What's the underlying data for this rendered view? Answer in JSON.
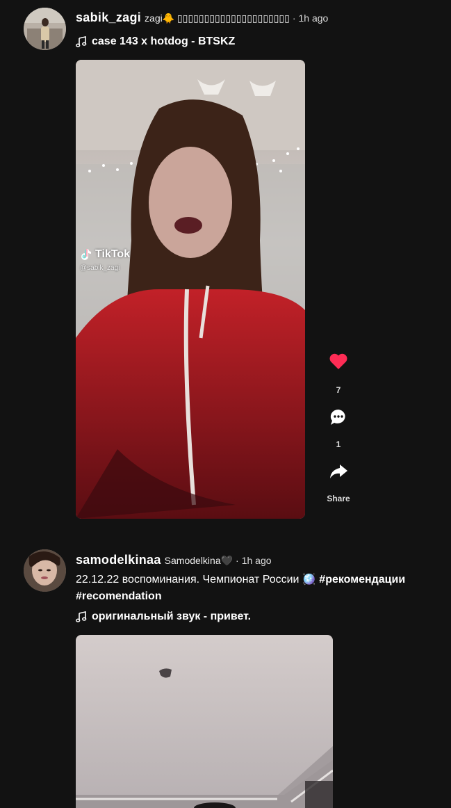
{
  "posts": [
    {
      "username": "sabik_zagi",
      "nickname": "zagi🐥 ▯▯▯▯▯▯▯▯▯▯▯▯▯▯▯▯▯▯▯▯▯",
      "separator": "·",
      "time": "1h ago",
      "music": "case 143 x hotdog - BTSKZ",
      "watermark": {
        "logo": "TikTok",
        "handle": "@sabik_zagi"
      },
      "actions": {
        "likes": "7",
        "comments": "1",
        "share_label": "Share"
      }
    },
    {
      "username": "samodelkinaa",
      "nickname": "Samodelkina🖤",
      "separator": "·",
      "time": "1h ago",
      "caption_text": "22.12.22 воспоминания. Чемпионат России 🪩",
      "hashtags": [
        "#рекомендации",
        "#recomendation"
      ],
      "music": "оригинальный звук - привет."
    }
  ],
  "colors": {
    "background": "#121212",
    "like": "#fe2c55"
  },
  "icons": {
    "music": "music-note-icon",
    "like": "heart-icon",
    "comment": "comment-icon",
    "share": "share-icon"
  }
}
